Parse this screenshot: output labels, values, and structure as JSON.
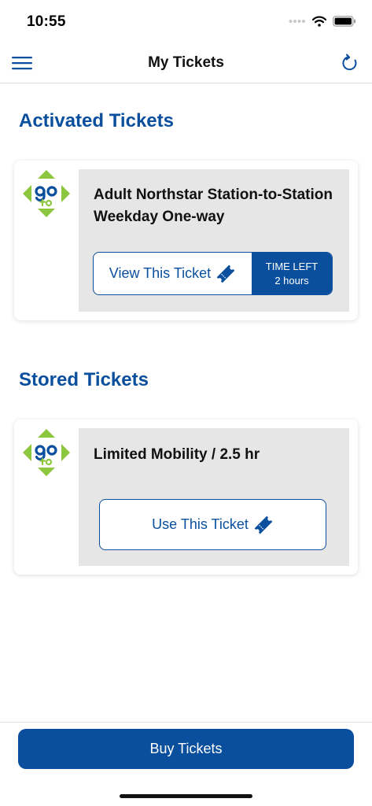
{
  "status_bar": {
    "time": "10:55"
  },
  "header": {
    "title": "My Tickets"
  },
  "activated": {
    "section_title": "Activated Tickets",
    "ticket": {
      "name": "Adult Northstar Station-to-Station Weekday One-way",
      "view_label": "View This Ticket",
      "time_left_label": "TIME LEFT",
      "time_left_value": "2 hours"
    }
  },
  "stored": {
    "section_title": "Stored Tickets",
    "ticket": {
      "name": "Limited Mobility / 2.5 hr",
      "use_label": "Use This Ticket"
    }
  },
  "footer": {
    "buy_label": "Buy Tickets"
  },
  "colors": {
    "brand_blue": "#0a4f9e",
    "logo_green": "#8dc63f",
    "panel_gray": "#e6e6e6"
  }
}
